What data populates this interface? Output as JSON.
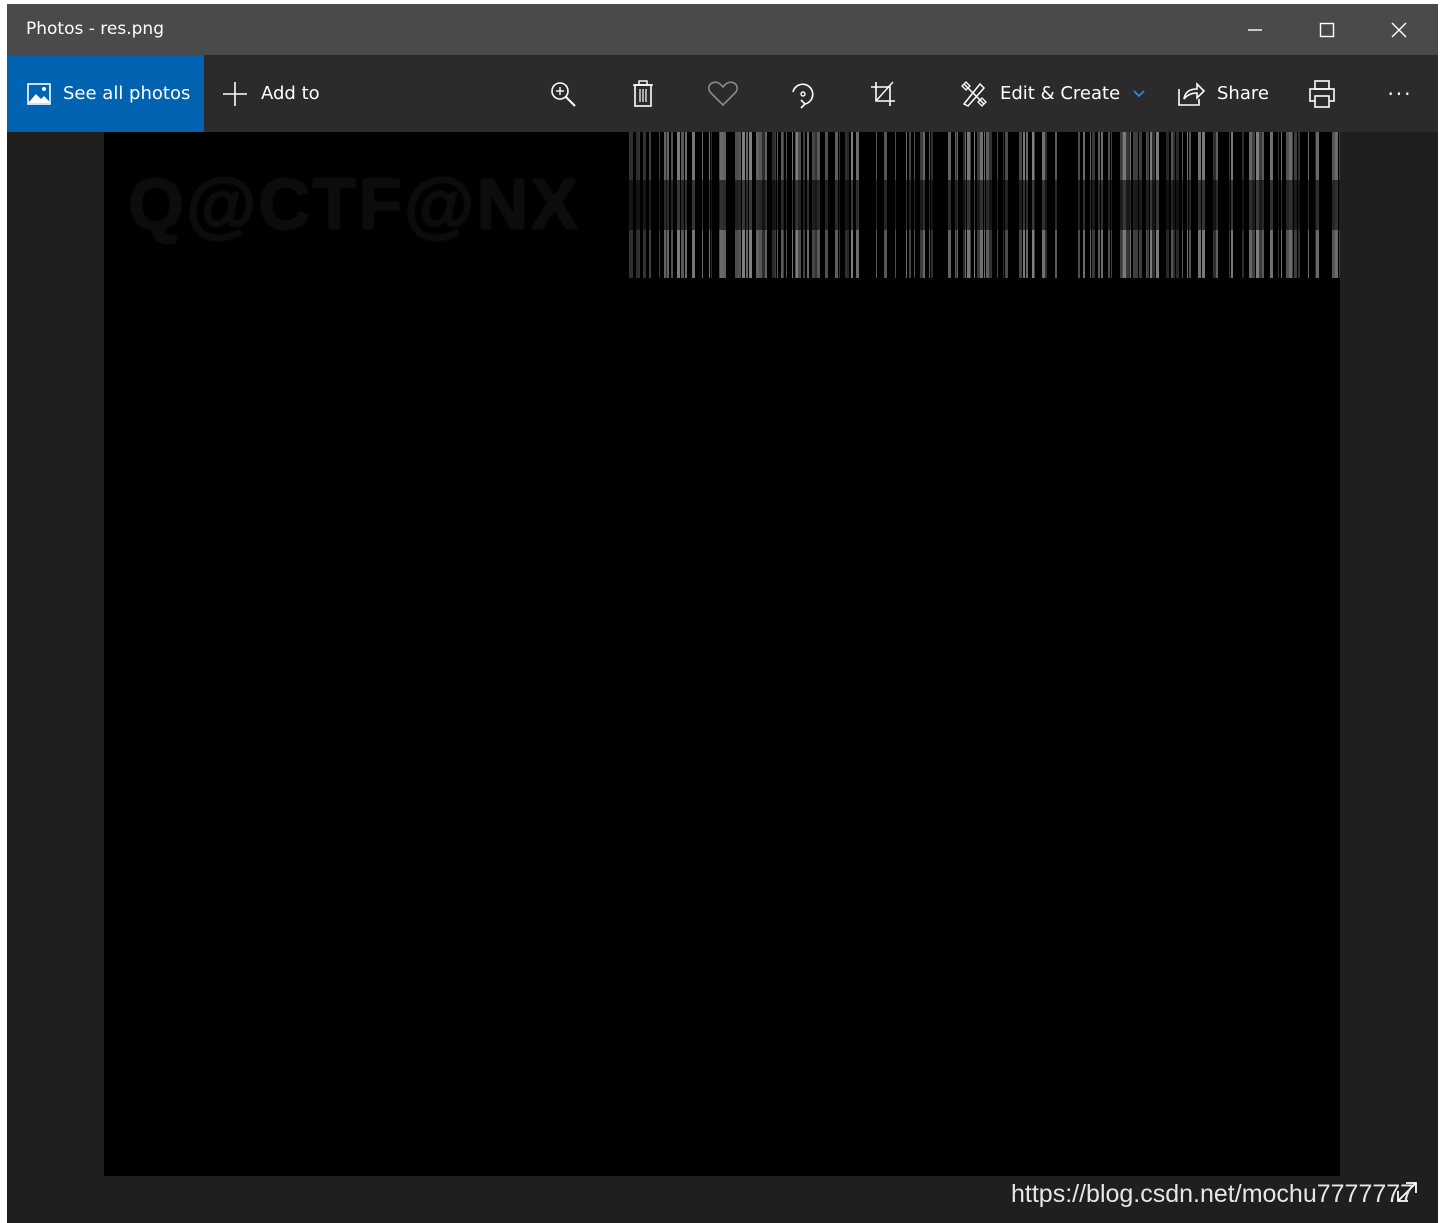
{
  "window": {
    "title": "Photos - res.png"
  },
  "toolbar": {
    "see_all_label": "See all photos",
    "add_to_label": "Add to",
    "edit_create_label": "Edit & Create",
    "share_label": "Share",
    "more_label": "···",
    "accent_color": "#0063b1"
  },
  "photo": {
    "overlay_text": "Q@CTF@NX"
  },
  "watermark": {
    "text": "https://blog.csdn.net/mochu7777777"
  },
  "icons": {
    "see_all": "photos-icon",
    "add": "plus-icon",
    "zoom": "zoom-in-icon",
    "delete": "trash-icon",
    "favorite": "heart-icon",
    "rotate": "rotate-icon",
    "crop": "crop-icon",
    "edit": "edit-create-icon",
    "share": "share-icon",
    "print": "print-icon",
    "expand": "expand-icon"
  }
}
